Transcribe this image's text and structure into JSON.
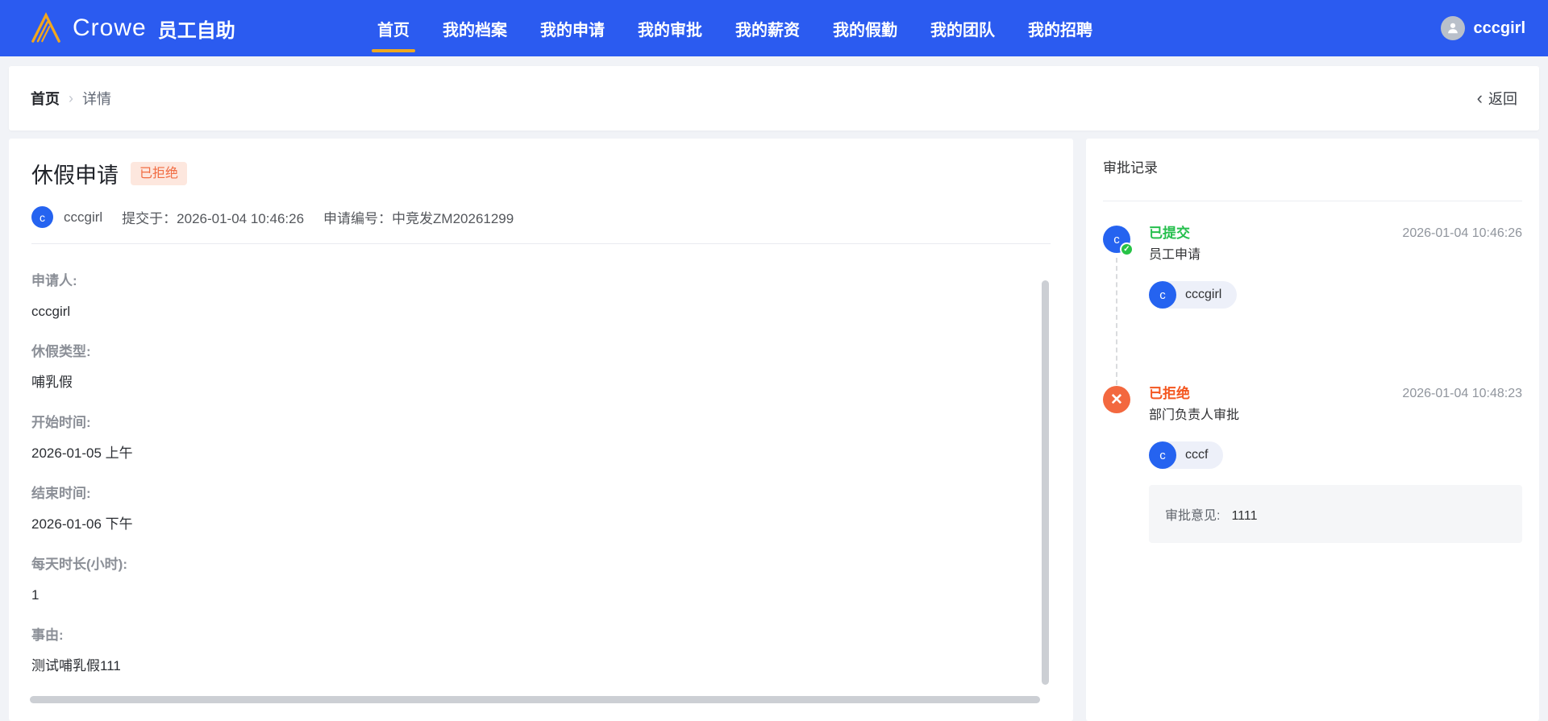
{
  "header": {
    "brand": "Crowe",
    "app_title": "员工自助",
    "nav": [
      {
        "label": "首页",
        "active": true
      },
      {
        "label": "我的档案",
        "active": false
      },
      {
        "label": "我的申请",
        "active": false
      },
      {
        "label": "我的审批",
        "active": false
      },
      {
        "label": "我的薪资",
        "active": false
      },
      {
        "label": "我的假勤",
        "active": false
      },
      {
        "label": "我的团队",
        "active": false
      },
      {
        "label": "我的招聘",
        "active": false
      }
    ],
    "user": "cccgirl"
  },
  "breadcrumb": {
    "home": "首页",
    "current": "详情",
    "back_label": "返回"
  },
  "request": {
    "title": "休假申请",
    "status_badge": "已拒绝",
    "submitter_avatar_letter": "c",
    "submitter": "cccgirl",
    "submitted_label": "提交于：",
    "submitted_at": "2026-01-04 10:46:26",
    "request_no_label": "申请编号：",
    "request_no": "中竞发ZM20261299",
    "fields": [
      {
        "label": "申请人:",
        "value": "cccgirl"
      },
      {
        "label": "休假类型:",
        "value": "哺乳假"
      },
      {
        "label": "开始时间:",
        "value": "2026-01-05 上午"
      },
      {
        "label": "结束时间:",
        "value": "2026-01-06 下午"
      },
      {
        "label": "每天时长(小时):",
        "value": "1"
      },
      {
        "label": "事由:",
        "value": "测试哺乳假111"
      }
    ]
  },
  "approval": {
    "title": "审批记录",
    "records": [
      {
        "status": "已提交",
        "step": "员工申请",
        "time": "2026-01-04 10:46:26",
        "avatar_letter": "c",
        "assignee": "cccgirl"
      },
      {
        "status": "已拒绝",
        "step": "部门负责人审批",
        "time": "2026-01-04 10:48:23",
        "avatar_letter": "c",
        "assignee": "cccf",
        "comment_label": "审批意见:",
        "comment": "1111"
      }
    ]
  },
  "icons": {
    "reject_x": "✕",
    "check": "✓",
    "breadcrumb_separator": "›",
    "back_chevron": "‹"
  },
  "accent_colors": {
    "header_blue": "#2b5bf0",
    "active_tab_underline": "#efa91f",
    "logo_gold": "#f2a71d",
    "avatar_blue": "#2563f0",
    "success_green": "#25bf4d",
    "reject_orange": "#f3683f",
    "badge_bg": "#fde7de",
    "badge_text": "#f16c42"
  }
}
